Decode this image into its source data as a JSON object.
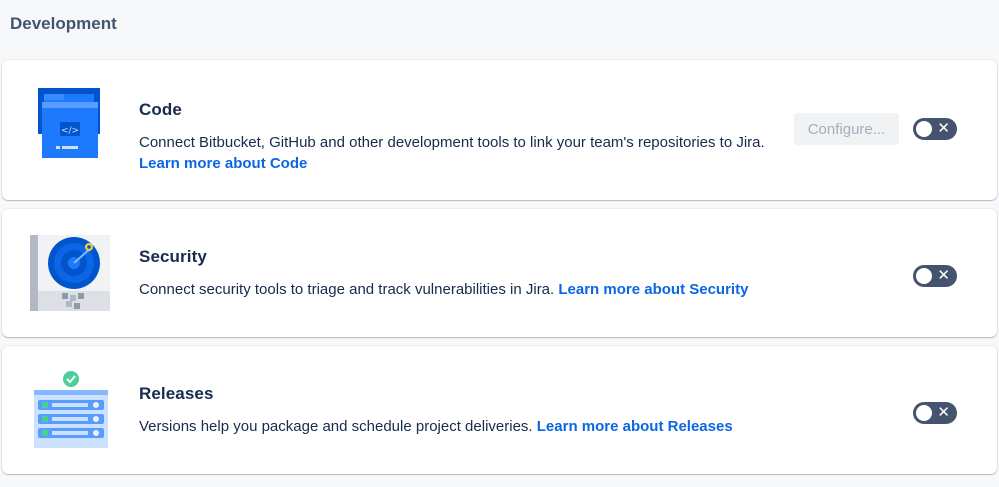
{
  "section": {
    "title": "Development"
  },
  "features": {
    "code": {
      "title": "Code",
      "description": "Connect Bitbucket, GitHub and other development tools to link your team's repositories to Jira.",
      "link": "Learn more about Code",
      "configure_label": "Configure...",
      "toggle_symbol": "✕"
    },
    "security": {
      "title": "Security",
      "description": "Connect security tools to triage and track vulnerabilities in Jira.",
      "link": "Learn more about Security",
      "toggle_symbol": "✕"
    },
    "releases": {
      "title": "Releases",
      "description": "Versions help you package and schedule project deliveries.",
      "link": "Learn more about Releases",
      "toggle_symbol": "✕"
    }
  },
  "colors": {
    "link": "#0c66e4",
    "toggle_off": "#44546f",
    "text": "#172b4d",
    "heading": "#44546f"
  },
  "icons": {
    "code": "code-folder-illustration",
    "security": "security-radar-illustration",
    "releases": "releases-server-illustration"
  }
}
